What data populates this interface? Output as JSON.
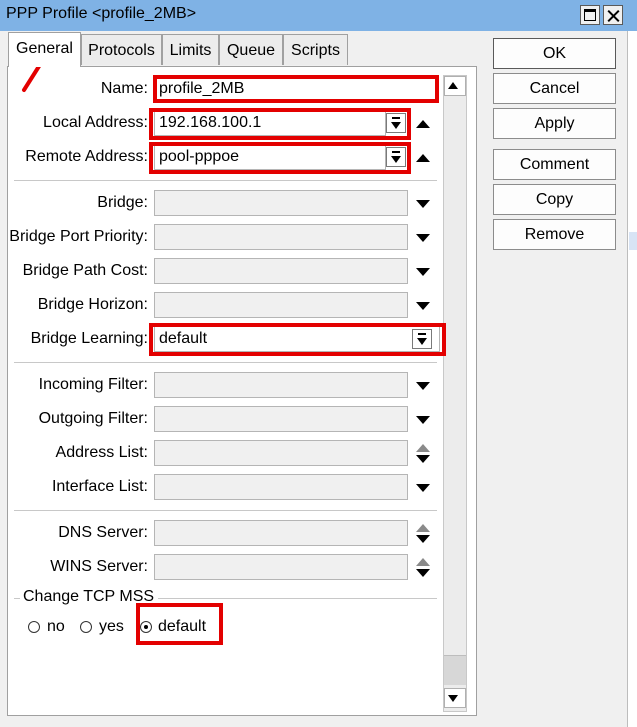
{
  "window": {
    "title": "PPP Profile <profile_2MB>"
  },
  "tabs": [
    {
      "label": "General",
      "active": true
    },
    {
      "label": "Protocols",
      "active": false
    },
    {
      "label": "Limits",
      "active": false
    },
    {
      "label": "Queue",
      "active": false
    },
    {
      "label": "Scripts",
      "active": false
    }
  ],
  "form": {
    "name": {
      "label": "Name:",
      "value": "profile_2MB"
    },
    "local_address": {
      "label": "Local Address:",
      "value": "192.168.100.1"
    },
    "remote_address": {
      "label": "Remote Address:",
      "value": "pool-pppoe"
    },
    "bridge": {
      "label": "Bridge:",
      "value": ""
    },
    "bridge_port_priority": {
      "label": "Bridge Port Priority:",
      "value": ""
    },
    "bridge_path_cost": {
      "label": "Bridge Path Cost:",
      "value": ""
    },
    "bridge_horizon": {
      "label": "Bridge Horizon:",
      "value": ""
    },
    "bridge_learning": {
      "label": "Bridge Learning:",
      "value": "default"
    },
    "incoming_filter": {
      "label": "Incoming Filter:",
      "value": ""
    },
    "outgoing_filter": {
      "label": "Outgoing Filter:",
      "value": ""
    },
    "address_list": {
      "label": "Address List:",
      "value": ""
    },
    "interface_list": {
      "label": "Interface List:",
      "value": ""
    },
    "dns_server": {
      "label": "DNS Server:",
      "value": ""
    },
    "wins_server": {
      "label": "WINS Server:",
      "value": ""
    },
    "change_tcp_mss": {
      "label": "Change TCP MSS",
      "options": [
        "no",
        "yes",
        "default"
      ],
      "selected": "default"
    }
  },
  "buttons": {
    "ok": "OK",
    "cancel": "Cancel",
    "apply": "Apply",
    "comment": "Comment",
    "copy": "Copy",
    "remove": "Remove"
  },
  "colors": {
    "titlebar": "#7fb2e5",
    "highlight_box": "#e30000",
    "annotation_arrow": "#e30000"
  }
}
